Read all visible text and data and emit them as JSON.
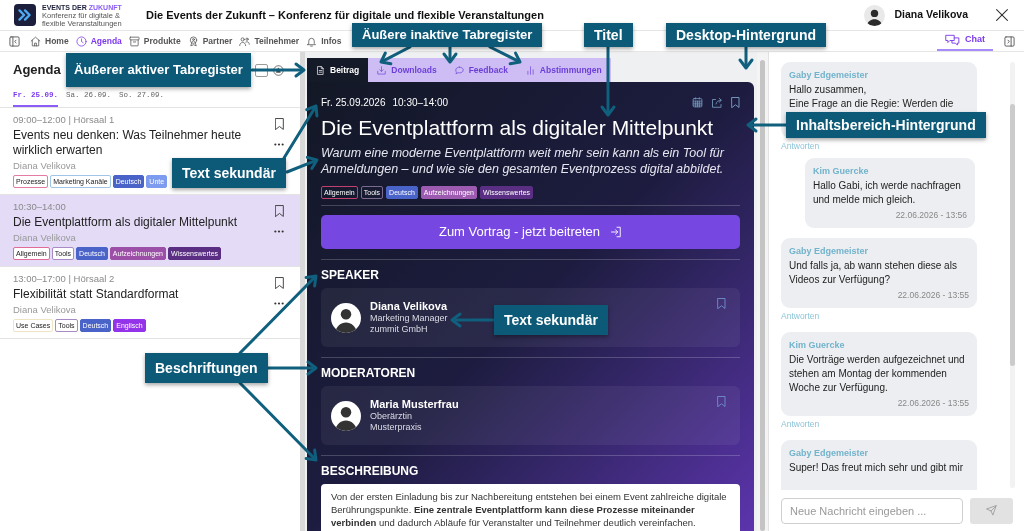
{
  "header": {
    "brand": "EVENTS DER",
    "brand_accent": "ZUKUNFT",
    "tagline": "Konferenz für digitale & flexible Veranstaltungen",
    "title": "Die Events der Zukunft – Konferenz für digitale und flexible Veranstaltungen",
    "user": "Diana Velikova"
  },
  "nav": {
    "items": [
      {
        "label": "Home",
        "selected": false
      },
      {
        "label": "Agenda",
        "selected": true
      },
      {
        "label": "Produkte",
        "selected": false
      },
      {
        "label": "Partner",
        "selected": false
      },
      {
        "label": "Teilnehmer",
        "selected": false
      },
      {
        "label": "Infos",
        "selected": false
      }
    ],
    "chat_tab": {
      "label": "Chat",
      "selected": true
    }
  },
  "agenda": {
    "title": "Agenda",
    "days": [
      {
        "label": "Fr. 25.09.",
        "selected": true
      },
      {
        "label": "Sa. 26.09.",
        "selected": false
      },
      {
        "label": "So. 27.09.",
        "selected": false
      }
    ],
    "sessions": [
      {
        "time": "09:00–12:00 | Hörsaal 1",
        "title": "Events neu denken: Was Teilnehmer heute wirklich erwarten",
        "speaker": "Diana Velikova",
        "selected": false,
        "tags": [
          {
            "label": "Prozesse",
            "kind": "outline",
            "color": "#e57aa5"
          },
          {
            "label": "Marketing Kanäle",
            "kind": "outline",
            "color": "#9fc6e6"
          },
          {
            "label": "Deutsch",
            "kind": "filled",
            "color": "#4a63c9"
          },
          {
            "label": "Unte",
            "kind": "filled",
            "color": "#7d9cf0"
          }
        ]
      },
      {
        "time": "10:30–14:00",
        "title": "Die Eventplattform als digitaler Mittelpunkt",
        "speaker": "Diana Velikova",
        "selected": true,
        "tags": [
          {
            "label": "Allgemein",
            "kind": "outline",
            "color": "#e06b97"
          },
          {
            "label": "Tools",
            "kind": "outline",
            "color": "#a88bc4"
          },
          {
            "label": "Deutsch",
            "kind": "filled",
            "color": "#4a63c9"
          },
          {
            "label": "Aufzeichnungen",
            "kind": "filled",
            "color": "#9c4fa6"
          },
          {
            "label": "Wissenswertes",
            "kind": "filled",
            "color": "#5a2f83"
          }
        ]
      },
      {
        "time": "13:00–17:00 | Hörsaal 2",
        "title": "Flexibilität statt Standardformat",
        "speaker": "Diana Velikova",
        "selected": false,
        "tags": [
          {
            "label": "Use Cases",
            "kind": "outline",
            "color": "#efe4c4"
          },
          {
            "label": "Tools",
            "kind": "outline",
            "color": "#a88bc4"
          },
          {
            "label": "Deutsch",
            "kind": "filled",
            "color": "#4a63c9"
          },
          {
            "label": "Englisch",
            "kind": "filled",
            "color": "#9333ea"
          }
        ]
      }
    ]
  },
  "content": {
    "tabs": [
      {
        "label": "Beitrag",
        "selected": true
      },
      {
        "label": "Downloads",
        "selected": false
      },
      {
        "label": "Feedback",
        "selected": false
      },
      {
        "label": "Abstimmungen",
        "selected": false
      }
    ],
    "session": {
      "date": "Fr. 25.09.2026",
      "time": "10:30–14:00",
      "title": "Die Eventplattform als digitaler Mittelpunkt",
      "subtitle": "Warum eine moderne Eventplattform weit mehr sein kann als ein Tool für Anmeldungen – und wie sie den gesamten Eventprozess digital abbildet.",
      "tags": [
        {
          "label": "Allgemein",
          "kind": "outline",
          "color": "#c2406f"
        },
        {
          "label": "Tools",
          "kind": "outline",
          "color": "#7a6a8e"
        },
        {
          "label": "Deutsch",
          "kind": "filled",
          "color": "#4a63c9"
        },
        {
          "label": "Aufzeichnungen",
          "kind": "filled",
          "color": "#9c5bb0"
        },
        {
          "label": "Wissenswertes",
          "kind": "filled",
          "color": "#5a2f83"
        }
      ],
      "join_button": "Zum Vortrag - jetzt beitreten",
      "sections": [
        {
          "heading": "SPEAKER",
          "kind": "people",
          "people": [
            {
              "name": "Diana Velikova",
              "role": "Marketing Manager",
              "company": "zummit GmbH"
            }
          ]
        },
        {
          "heading": "MODERATOREN",
          "kind": "people",
          "people": [
            {
              "name": "Maria Musterfrau",
              "role": "Oberärztin",
              "company": "Musterpraxis"
            }
          ]
        },
        {
          "heading": "BESCHREIBUNG",
          "kind": "text",
          "text": "Von der ersten Einladung bis zur Nachbereitung entstehen bei einem Event zahlreiche digitale Berührungspunkte. **Eine zentrale Eventplattform kann diese Prozesse miteinander verbinden** und dadurch Abläufe für Veranstalter und Teilnehmer deutlich vereinfachen."
        }
      ]
    }
  },
  "chat": {
    "messages": [
      {
        "author": "Gaby Edgemeister",
        "text": "Hallo zusammen,\nEine Frage an die Regie: Werden die",
        "kind": "post",
        "reply_link": "Antworten"
      },
      {
        "author": "Kim Guercke",
        "text": "Hallo Gabi, ich werde nachfragen und melde mich gleich.",
        "time": "22.06.2026 - 13:56",
        "kind": "reply"
      },
      {
        "author": "Gaby Edgemeister",
        "text": "Und falls ja, ab wann stehen diese als Videos zur Verfügung?",
        "time": "22.06.2026 - 13:55",
        "kind": "post",
        "reply_link": "Antworten"
      },
      {
        "author": "Kim Guercke",
        "text": "Die Vorträge werden aufgezeichnet und stehen am Montag der kommenden Woche zur Verfügung.",
        "time": "22.06.2026 - 13:55",
        "kind": "post",
        "reply_link": "Antworten"
      },
      {
        "author": "Gaby Edgemeister",
        "text": "Super! Das freut mich sehr und gibt mir",
        "kind": "post"
      }
    ],
    "input": {
      "placeholder": "Neue Nachricht eingeben ..."
    }
  },
  "annotations": [
    {
      "text": "Äußerer aktiver Tabregister"
    },
    {
      "text": "Äußere inaktive Tabregister"
    },
    {
      "text": "Titel"
    },
    {
      "text": "Desktop-Hintergrund"
    },
    {
      "text": "Inhaltsbereich-Hintergrund"
    },
    {
      "text": "Text sekundär"
    },
    {
      "text": "Text sekundär"
    },
    {
      "text": "Beschriftungen"
    }
  ]
}
